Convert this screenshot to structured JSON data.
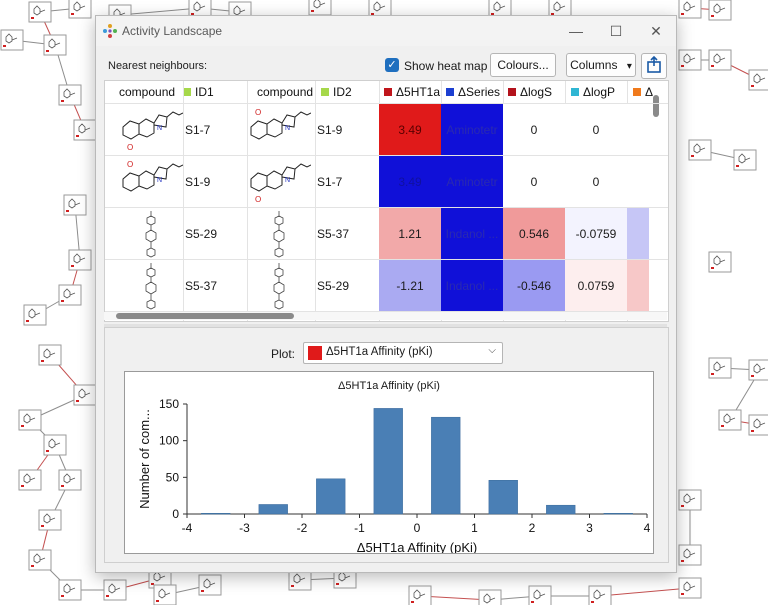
{
  "window": {
    "title": "Activity Landscape",
    "controls": {
      "minimize": "—",
      "maximize": "☐",
      "close": "✕"
    }
  },
  "toolbar": {
    "nearest_label": "Nearest neighbours:",
    "heatmap_label": "Show heat map",
    "heatmap_checked": true,
    "colours_button": "Colours...",
    "columns_button": "Columns",
    "columns_arrow": "▾"
  },
  "table": {
    "columns": [
      {
        "label": "compound",
        "color": ""
      },
      {
        "label": "ID1",
        "color": "#a6d84a"
      },
      {
        "label": "compound",
        "color": ""
      },
      {
        "label": "ID2",
        "color": "#a6d84a"
      },
      {
        "label": "Δ5HT1a",
        "color": "#c0151b"
      },
      {
        "label": "ΔSeries",
        "color": "#1c3fd1"
      },
      {
        "label": "ΔlogS",
        "color": "#b3121c"
      },
      {
        "label": "ΔlogP",
        "color": "#2fb6d3"
      },
      {
        "label": "Δ",
        "color": "#f07a1c"
      }
    ],
    "rows": [
      {
        "id1": "S1-7",
        "id2": "S1-9",
        "d5ht1a": "3.49",
        "dseries": "Aminotetr",
        "dlogs": "0",
        "dlogp": "0"
      },
      {
        "id1": "S1-9",
        "id2": "S1-7",
        "d5ht1a": "3.49",
        "dseries": "Aminotetr",
        "dlogs": "0",
        "dlogp": "0"
      },
      {
        "id1": "S5-29",
        "id2": "S5-37",
        "d5ht1a": "1.21",
        "dseries": "Indanol ...",
        "dlogs": "0.546",
        "dlogp": "-0.0759"
      },
      {
        "id1": "S5-37",
        "id2": "S5-29",
        "d5ht1a": "-1.21",
        "dseries": "Indanol ...",
        "dlogs": "-0.546",
        "dlogp": "0.0759"
      }
    ],
    "heat_colors": {
      "d5ht1a": [
        "#e01a1a",
        "#1010d8",
        "#f2a9a9",
        "#aaaaf2"
      ],
      "dseries": [
        "#1010d8",
        "#1010d8",
        "#1010d8",
        "#1010d8"
      ],
      "dlogs": [
        "#ffffff",
        "#ffffff",
        "#f09a9a",
        "#9a9af2"
      ],
      "dlogp": [
        "#ffffff",
        "#ffffff",
        "#f3f3fe",
        "#fdeeee"
      ],
      "extra": [
        "#ffffff",
        "#ffffff",
        "#c6c6f6",
        "#f7c8c8"
      ]
    }
  },
  "plot": {
    "label": "Plot:",
    "selected": "Δ5HT1a Affinity (pKi)",
    "selected_color": "#e01a1a",
    "arrow": "⌵"
  },
  "chart_data": {
    "type": "bar",
    "title": "Δ5HT1a Affinity (pKi)",
    "xlabel": "Δ5HT1a Affinity (pKi)",
    "ylabel": "Number of com...",
    "categories": [
      -3.5,
      -2.5,
      -1.5,
      -0.5,
      0.5,
      1.5,
      2.5,
      3.5
    ],
    "values": [
      1,
      13,
      48,
      144,
      132,
      46,
      12,
      1
    ],
    "bin_width": 1,
    "xlim": [
      -4,
      4
    ],
    "ylim": [
      0,
      150
    ],
    "xticks": [
      -4,
      -3,
      -2,
      -1,
      0,
      1,
      2,
      3,
      4
    ],
    "yticks": [
      0,
      50,
      100,
      150
    ],
    "bar_color": "#4a7fb5"
  }
}
